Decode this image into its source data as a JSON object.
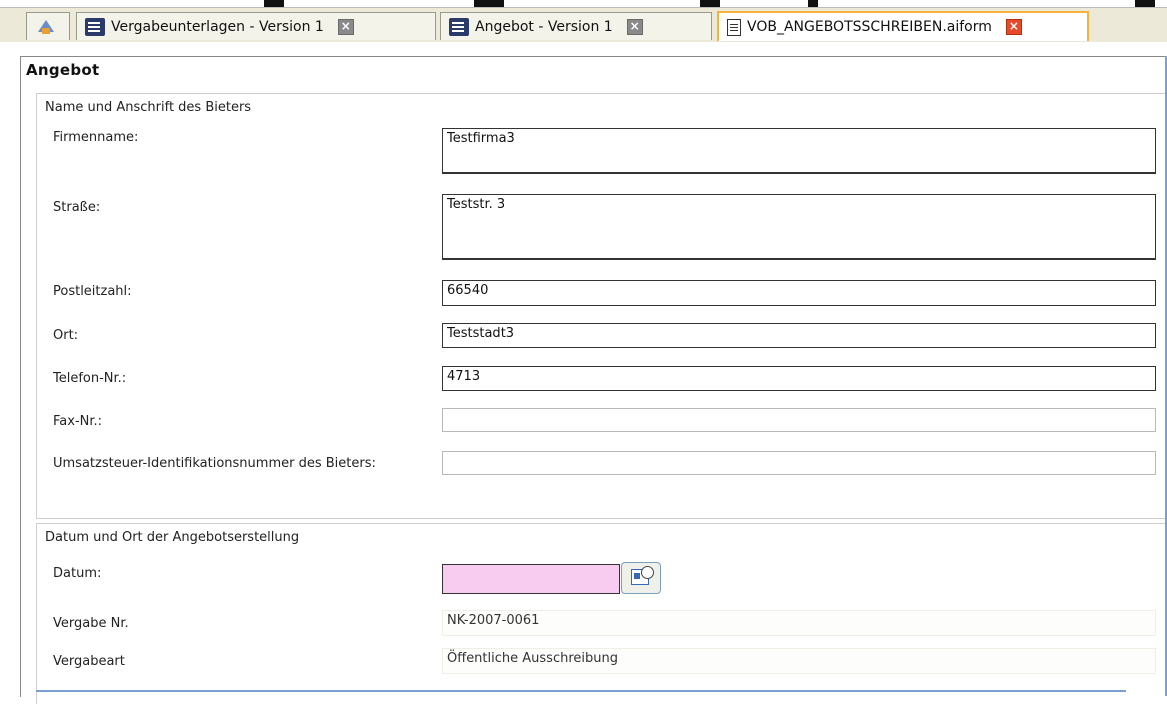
{
  "tabs": [
    {
      "label": ""
    },
    {
      "label": "Vergabeunterlagen - Version 1"
    },
    {
      "label": "Angebot - Version 1"
    },
    {
      "label": "VOB_ANGEBOTSSCHREIBEN.aiform"
    }
  ],
  "form": {
    "title": "Angebot",
    "section1": {
      "title": "Name und Anschrift des Bieters",
      "firmenname_label": "Firmenname:",
      "firmenname_value": "Testfirma3",
      "strasse_label": "Straße:",
      "strasse_value": "Teststr. 3",
      "plz_label": "Postleitzahl:",
      "plz_value": "66540",
      "ort_label": "Ort:",
      "ort_value": "Teststadt3",
      "telefon_label": "Telefon-Nr.:",
      "telefon_value": "4713",
      "fax_label": "Fax-Nr.:",
      "fax_value": "",
      "ust_label": "Umsatzsteuer-Identifikationsnummer des Bieters:",
      "ust_value": ""
    },
    "section2": {
      "title": "Datum und Ort der Angebotserstellung",
      "datum_label": "Datum:",
      "datum_value": "",
      "vergabe_nr_label": "Vergabe Nr.",
      "vergabe_nr_value": "NK-2007-0061",
      "vergabeart_label": "Vergabeart",
      "vergabeart_value": "Öffentliche Ausschreibung"
    }
  },
  "colors": {
    "active_tab_border": "#f5b43c",
    "date_field_bg": "#f8ccf0",
    "close_active": "#e64a2a"
  }
}
